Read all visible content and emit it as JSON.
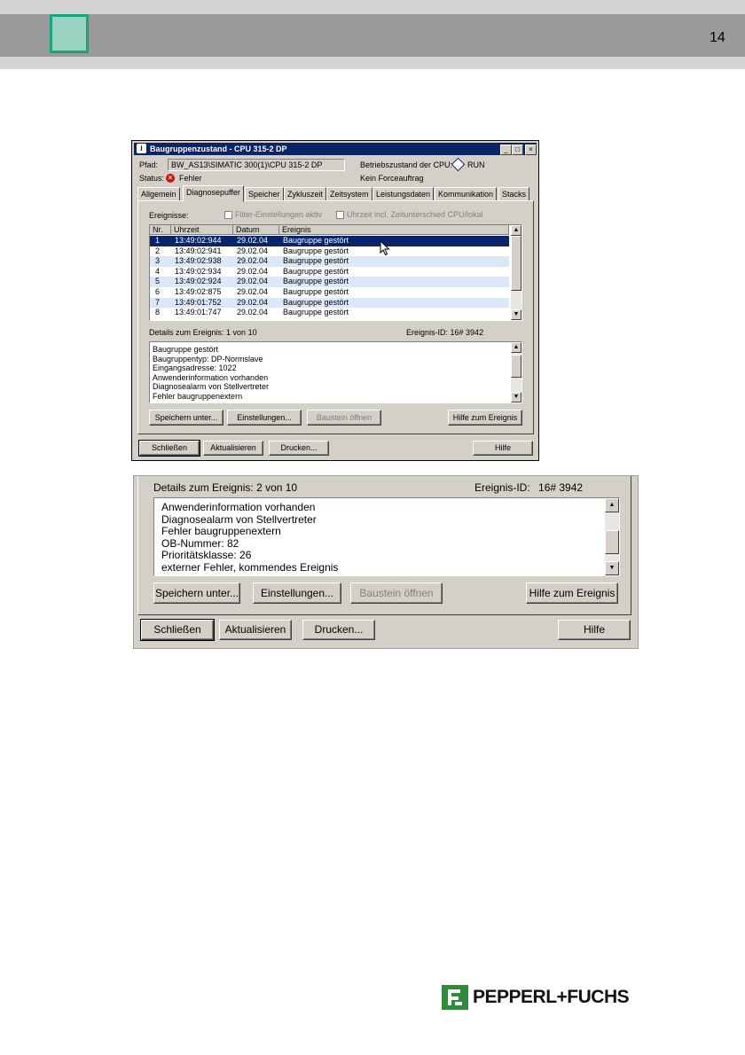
{
  "page": {
    "number": "14"
  },
  "dialog1": {
    "title": "Baugruppenzustand - CPU 315-2 DP",
    "window_buttons": [
      "_",
      "□",
      "×"
    ],
    "pfad_label": "Pfad:",
    "pfad_value": "BW_AS13\\SIMATIC 300(1)\\CPU 315-2 DP",
    "status_label": "Status:",
    "status_value": "Fehler",
    "betrieb_label": "Betriebszustand der CPU:",
    "betrieb_value": "RUN",
    "force_text": "Kein Forceauftrag",
    "tabs": [
      "Allgemein",
      "Diagnosepuffer",
      "Speicher",
      "Zykluszeit",
      "Zeitsystem",
      "Leistungsdaten",
      "Kommunikation",
      "Stacks"
    ],
    "active_tab": "Diagnosepuffer",
    "ereignisse_label": "Ereignisse:",
    "filter_label": "Filter-Einstellungen aktiv",
    "uhrzeit_label": "Uhrzeit incl. Zeitunterschied CPU/lokal",
    "columns": [
      "Nr.",
      "Uhrzeit",
      "Datum",
      "Ereignis"
    ],
    "rows": [
      {
        "nr": "1",
        "time": "13:49:02:944",
        "date": "29.02.04",
        "event": "Baugruppe gestört"
      },
      {
        "nr": "2",
        "time": "13:49:02:941",
        "date": "29.02.04",
        "event": "Baugruppe gestört"
      },
      {
        "nr": "3",
        "time": "13:49:02:938",
        "date": "29.02.04",
        "event": "Baugruppe gestört"
      },
      {
        "nr": "4",
        "time": "13:49:02:934",
        "date": "29.02.04",
        "event": "Baugruppe gestört"
      },
      {
        "nr": "5",
        "time": "13:49:02:924",
        "date": "29.02.04",
        "event": "Baugruppe gestört"
      },
      {
        "nr": "6",
        "time": "13:49:02:875",
        "date": "29.02.04",
        "event": "Baugruppe gestört"
      },
      {
        "nr": "7",
        "time": "13:49:01:752",
        "date": "29.02.04",
        "event": "Baugruppe gestört"
      },
      {
        "nr": "8",
        "time": "13:49:01:747",
        "date": "29.02.04",
        "event": "Baugruppe gestört"
      }
    ],
    "details_label": "Details zum Ereignis:",
    "details_count": "1 von 10",
    "event_id_label": "Ereignis-ID:",
    "event_id_value": "16# 3942",
    "detail_lines": [
      "Baugruppe gestört",
      "Baugruppentyp: DP-Normslave",
      "Eingangsadresse: 1022",
      "Anwenderinformation vorhanden",
      "Diagnosealarm von Stellvertreter",
      "Fehler baugruppenextern"
    ],
    "btn_save": "Speichern unter...",
    "btn_settings": "Einstellungen...",
    "btn_open_block": "Baustein öffnen",
    "btn_help_event": "Hilfe zum Ereignis",
    "btn_close": "Schließen",
    "btn_refresh": "Aktualisieren",
    "btn_print": "Drucken...",
    "btn_help": "Hilfe"
  },
  "dialog2": {
    "details_label": "Details zum Ereignis:",
    "details_count": "2 von 10",
    "event_id_label": "Ereignis-ID:",
    "event_id_value": "16# 3942",
    "detail_lines": [
      "Anwenderinformation vorhanden",
      "Diagnosealarm von Stellvertreter",
      "Fehler baugruppenextern",
      "OB-Nummer: 82",
      "Prioritätsklasse: 26",
      "externer Fehler, kommendes Ereignis"
    ],
    "btn_save": "Speichern unter...",
    "btn_settings": "Einstellungen...",
    "btn_open_block": "Baustein öffnen",
    "btn_help_event": "Hilfe zum Ereignis",
    "btn_close": "Schließen",
    "btn_refresh": "Aktualisieren",
    "btn_print": "Drucken...",
    "btn_help": "Hilfe"
  },
  "logo": {
    "text": "PEPPERL+FUCHS",
    "color": "#2e8b3a"
  }
}
